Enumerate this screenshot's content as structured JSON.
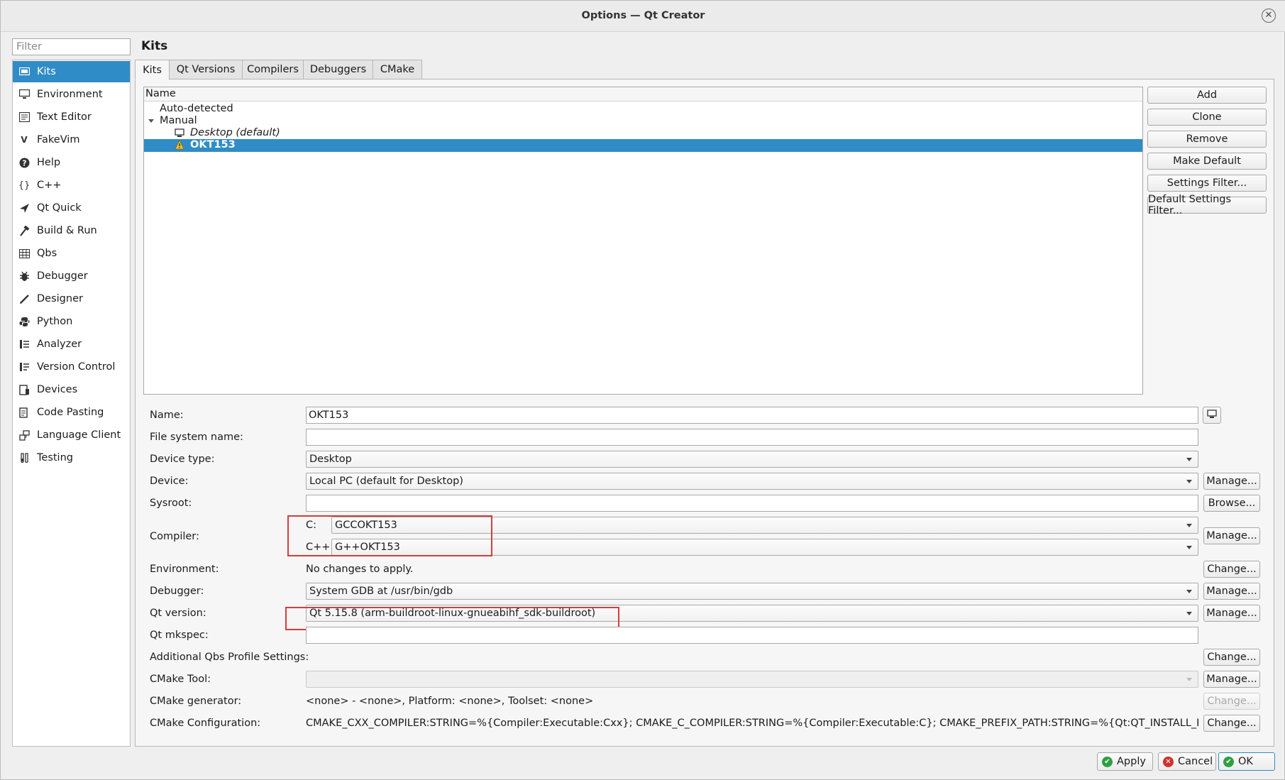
{
  "window": {
    "title": "Options — Qt Creator",
    "close_glyph": "✕"
  },
  "filter": {
    "placeholder": "Filter"
  },
  "sidebar": {
    "items": [
      {
        "label": "Kits",
        "icon": "kits-icon",
        "selected": true
      },
      {
        "label": "Environment",
        "icon": "monitor-icon"
      },
      {
        "label": "Text Editor",
        "icon": "text-editor-icon"
      },
      {
        "label": "FakeVim",
        "icon": "fakevim-icon"
      },
      {
        "label": "Help",
        "icon": "help-icon"
      },
      {
        "label": "C++",
        "icon": "braces-icon"
      },
      {
        "label": "Qt Quick",
        "icon": "qt-quick-icon"
      },
      {
        "label": "Build & Run",
        "icon": "hammer-icon"
      },
      {
        "label": "Qbs",
        "icon": "qbs-icon"
      },
      {
        "label": "Debugger",
        "icon": "bug-icon"
      },
      {
        "label": "Designer",
        "icon": "pencil-icon"
      },
      {
        "label": "Python",
        "icon": "python-icon"
      },
      {
        "label": "Analyzer",
        "icon": "analyzer-icon"
      },
      {
        "label": "Version Control",
        "icon": "version-control-icon"
      },
      {
        "label": "Devices",
        "icon": "devices-icon"
      },
      {
        "label": "Code Pasting",
        "icon": "code-pasting-icon"
      },
      {
        "label": "Language Client",
        "icon": "language-client-icon"
      },
      {
        "label": "Testing",
        "icon": "testing-icon"
      }
    ]
  },
  "page": {
    "title": "Kits"
  },
  "tabs": [
    {
      "label": "Kits",
      "active": true
    },
    {
      "label": "Qt Versions"
    },
    {
      "label": "Compilers"
    },
    {
      "label": "Debuggers"
    },
    {
      "label": "CMake"
    }
  ],
  "tree": {
    "header": "Name",
    "rows": [
      {
        "label": "Auto-detected"
      },
      {
        "label": "Manual",
        "expanded": true
      },
      {
        "label": "Desktop (default)",
        "italic": true,
        "icon": "desktop-icon"
      },
      {
        "label": "OKT153",
        "selected": true,
        "icon": "warning-icon"
      }
    ]
  },
  "kit_buttons": [
    "Add",
    "Clone",
    "Remove",
    "Make Default",
    "Settings Filter...",
    "Default Settings Filter..."
  ],
  "form": {
    "name": {
      "label": "Name:",
      "value": "OKT153"
    },
    "fs_name": {
      "label": "File system name:",
      "value": ""
    },
    "device_type": {
      "label": "Device type:",
      "value": "Desktop"
    },
    "device": {
      "label": "Device:",
      "value": "Local PC (default for Desktop)",
      "button": "Manage..."
    },
    "sysroot": {
      "label": "Sysroot:",
      "value": "",
      "button": "Browse..."
    },
    "compiler": {
      "label": "Compiler:",
      "c_label": "C:",
      "c_value": "GCCOKT153",
      "cxx_label": "C++:",
      "cxx_value": "G++OKT153",
      "button": "Manage..."
    },
    "environment": {
      "label": "Environment:",
      "value": "No changes to apply.",
      "button": "Change..."
    },
    "debugger": {
      "label": "Debugger:",
      "value": "System GDB at /usr/bin/gdb",
      "button": "Manage..."
    },
    "qt_version": {
      "label": "Qt version:",
      "value": "Qt 5.15.8 (arm-buildroot-linux-gnueabihf_sdk-buildroot)",
      "button": "Manage..."
    },
    "qt_mkspec": {
      "label": "Qt mkspec:",
      "value": ""
    },
    "qbs_profile": {
      "label": "Additional Qbs Profile Settings:",
      "button": "Change..."
    },
    "cmake_tool": {
      "label": "CMake Tool:",
      "value": "",
      "button": "Manage..."
    },
    "cmake_generator": {
      "label": "CMake generator:",
      "value": "<none> - <none>, Platform: <none>, Toolset: <none>",
      "button": "Change..."
    },
    "cmake_config": {
      "label": "CMake Configuration:",
      "value": "CMAKE_CXX_COMPILER:STRING=%{Compiler:Executable:Cxx}; CMAKE_C_COMPILER:STRING=%{Compiler:Executable:C}; CMAKE_PREFIX_PATH:STRING=%{Qt:QT_INSTALL_PREFIX}; QT...",
      "button": "Change..."
    }
  },
  "dialog_buttons": {
    "apply": "Apply",
    "cancel": "Cancel",
    "ok": "OK"
  },
  "colors": {
    "selection": "#308cc6",
    "highlight_box": "#d93b3b",
    "apply_icon": "#2ea043",
    "cancel_icon": "#d0312d"
  }
}
